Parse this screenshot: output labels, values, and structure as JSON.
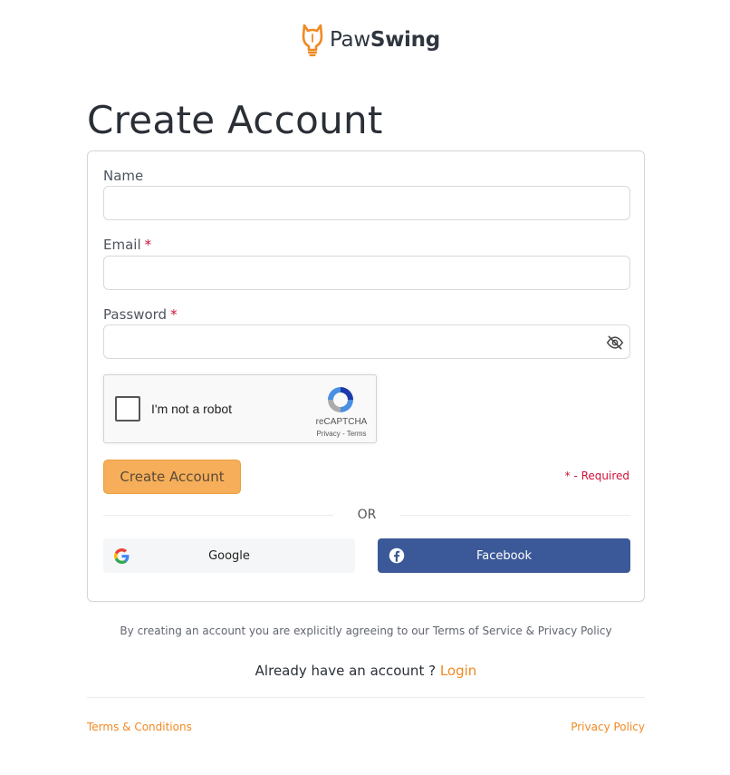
{
  "brand": {
    "name_part1": "Paw",
    "name_part2": "Swing",
    "icon": "cat-lightbulb-icon",
    "accent_color": "#f08a24"
  },
  "page": {
    "title": "Create Account"
  },
  "form": {
    "name_label": "Name",
    "email_label": "Email",
    "password_label": "Password",
    "required_marker": "*",
    "name_value": "",
    "email_value": "",
    "password_value": "",
    "password_toggle_icon": "eye-off-icon",
    "captcha": {
      "text": "I'm not a robot",
      "brand": "reCAPTCHA",
      "privacy": "Privacy",
      "separator": "-",
      "terms": "Terms"
    },
    "submit_label": "Create Account",
    "required_note": "* - Required",
    "or_text": "OR",
    "google_label": "Google",
    "facebook_label": "Facebook",
    "facebook_color": "#3b5998"
  },
  "agreement_text": "By creating an account you are explicitly agreeing to our Terms of Service & Privacy Policy",
  "login_prompt": {
    "text": "Already have an account ?",
    "link": "Login"
  },
  "footer": {
    "terms": "Terms & Conditions",
    "privacy": "Privacy Policy"
  }
}
